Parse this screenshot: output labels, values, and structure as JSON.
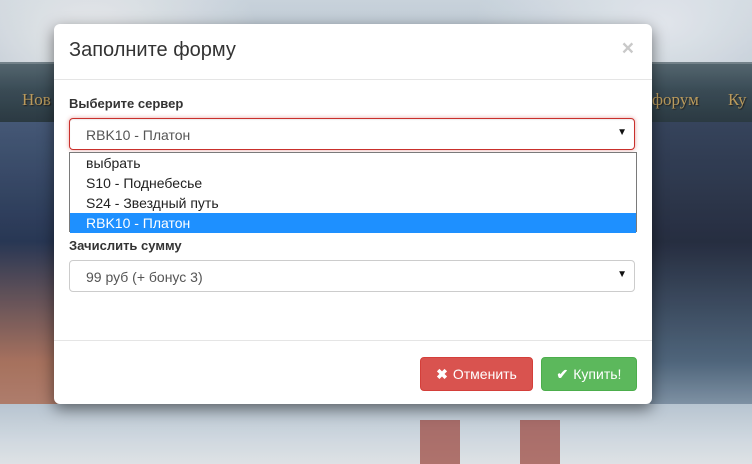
{
  "background": {
    "nav_items": [
      "Нов",
      "форум",
      "Ку"
    ]
  },
  "modal": {
    "title": "Заполните форму",
    "close_symbol": "×",
    "server": {
      "label": "Выберите сервер",
      "value": "RBK10 - Платон",
      "options": [
        "выбрать",
        "S10 - Поднебесье",
        "S24 - Звездный путь",
        "RBK10 - Платон"
      ],
      "selected_index": 3
    },
    "amount": {
      "label": "Зачислить сумму",
      "value": "99 руб (+ бонус 3)"
    },
    "buttons": {
      "cancel_label": "Отменить",
      "cancel_icon": "times-icon",
      "buy_label": "Купить!",
      "buy_icon": "check-icon"
    }
  },
  "colors": {
    "cancel": "#d9534f",
    "buy": "#5cb85c",
    "selected_option": "#1e90ff",
    "focus_border": "#c9302c"
  }
}
